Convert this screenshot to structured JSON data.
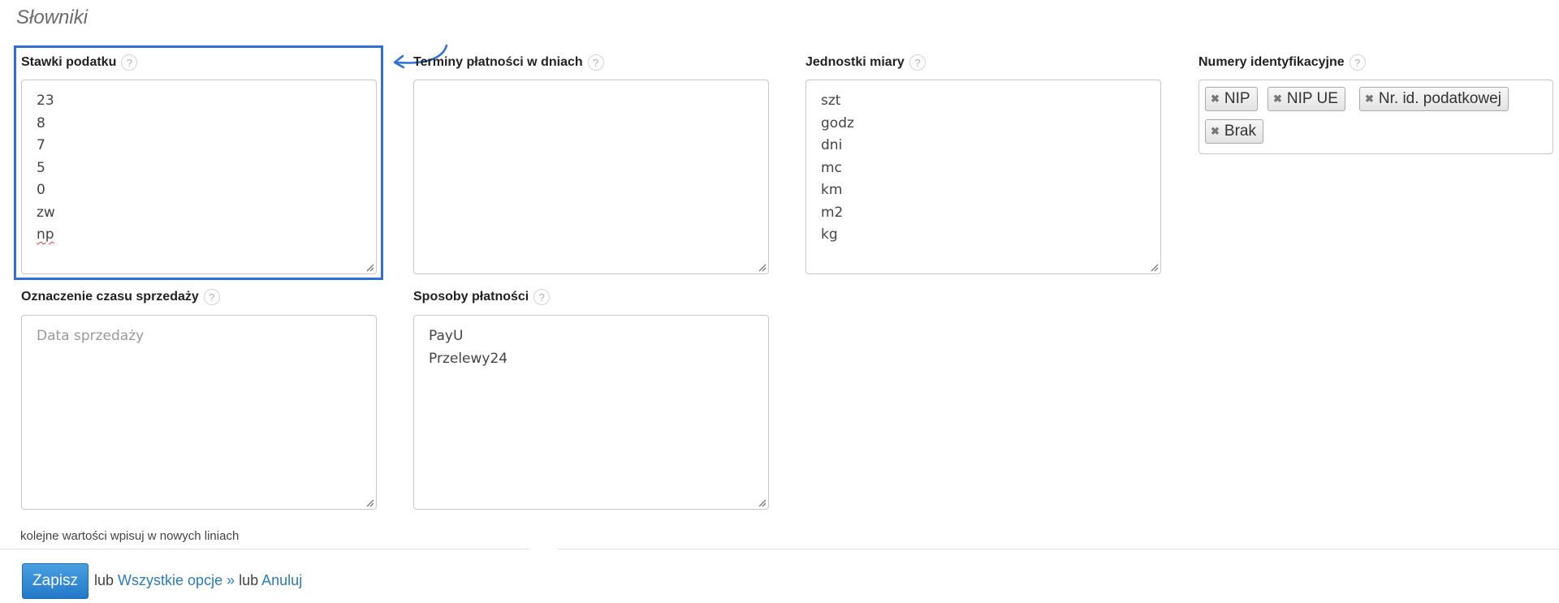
{
  "page": {
    "title": "Słowniki"
  },
  "fields": {
    "vat": {
      "label": "Stawki podatku",
      "lines": [
        "23",
        "8",
        "7",
        "5",
        "0",
        "zw",
        "np"
      ]
    },
    "terms": {
      "label": "Terminy płatności w dniach",
      "lines": []
    },
    "units": {
      "label": "Jednostki miary",
      "lines": [
        "szt",
        "godz",
        "dni",
        "mc",
        "km",
        "m2",
        "kg"
      ]
    },
    "ids": {
      "label": "Numery identyfikacyjne",
      "tags": [
        "NIP",
        "NIP UE",
        "Nr. id. podatkowej",
        "Brak"
      ]
    },
    "sale_time": {
      "label": "Oznaczenie czasu sprzedaży",
      "placeholder": "Data sprzedaży"
    },
    "payments": {
      "label": "Sposoby płatności",
      "lines": [
        "PayU",
        "Przelewy24"
      ]
    }
  },
  "help_glyph": "?",
  "tag_remove_glyph": "✖",
  "hint": "kolejne wartości wpisuj w nowych liniach",
  "footer": {
    "save": "Zapisz",
    "or1": "lub",
    "all_options": "Wszystkie opcje »",
    "or2": "lub",
    "cancel": "Anuluj"
  },
  "colors": {
    "accent": "#2f6fd6",
    "link": "#2a7bc0",
    "button": "#2379c9"
  }
}
